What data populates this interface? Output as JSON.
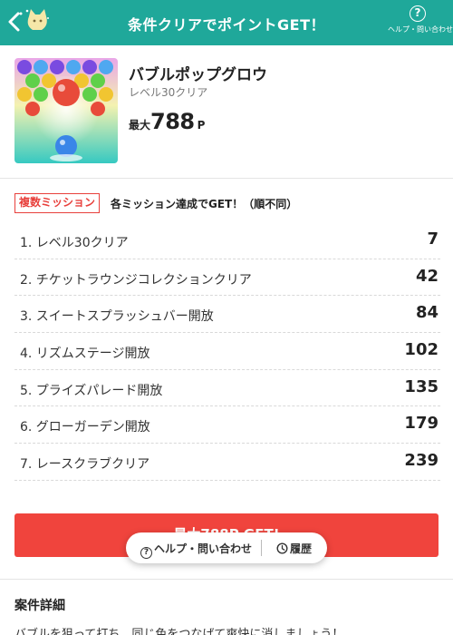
{
  "header": {
    "title": "条件クリアでポイントGET！",
    "help_label": "ヘルプ・問い合わせ",
    "help_glyph": "?",
    "back_icon": "chevron-left-icon",
    "mascot_icon": "cat-mascot-icon"
  },
  "app": {
    "name": "バブルポップグロウ",
    "subtitle": "レベル30クリア",
    "max_label": "最大",
    "max_points": "788",
    "max_unit": "P",
    "icon": "bubble-game-icon"
  },
  "missions": {
    "tag": "複数ミッション",
    "description": "各ミッション達成でGET！（順不同）",
    "items": [
      {
        "label": "1. レベル30クリア",
        "points": "7"
      },
      {
        "label": "2. チケットラウンジコレクションクリア",
        "points": "42"
      },
      {
        "label": "3. スイートスプラッシュバー開放",
        "points": "84"
      },
      {
        "label": "4. リズムステージ開放",
        "points": "102"
      },
      {
        "label": "5. プライズパレード開放",
        "points": "135"
      },
      {
        "label": "6. グローガーデン開放",
        "points": "179"
      },
      {
        "label": "7. レースクラブクリア",
        "points": "239"
      }
    ]
  },
  "cta": {
    "label": "最大788P GET!"
  },
  "floating_bar": {
    "help_label": "ヘルプ・問い合わせ",
    "history_label": "履歴",
    "help_glyph": "?"
  },
  "details": {
    "title": "案件詳細",
    "text": "バブルを狙って打ち、同じ色をつなげて爽快に消しましょう！"
  },
  "colors": {
    "header_bg": "#1fa89a",
    "cta_bg": "#f0443d",
    "tag_red": "#e8403c"
  }
}
